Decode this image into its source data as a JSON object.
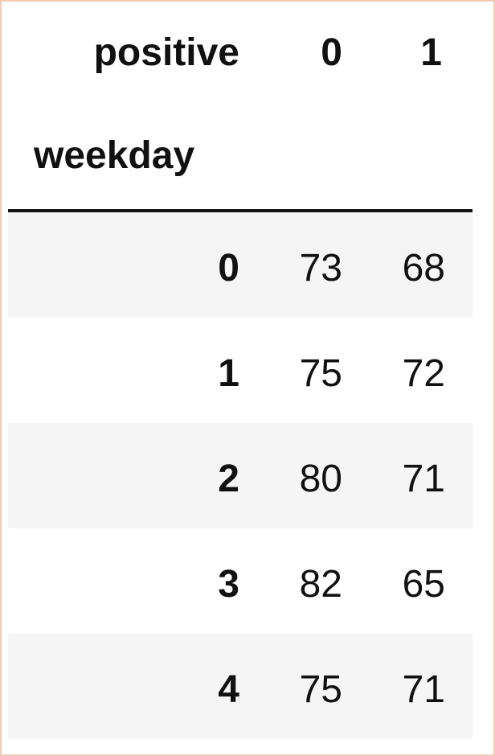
{
  "table": {
    "columns_name": "positive",
    "index_name": "weekday",
    "columns": [
      "0",
      "1"
    ],
    "rows": [
      {
        "index": "0",
        "values": [
          "73",
          "68"
        ]
      },
      {
        "index": "1",
        "values": [
          "75",
          "72"
        ]
      },
      {
        "index": "2",
        "values": [
          "80",
          "71"
        ]
      },
      {
        "index": "3",
        "values": [
          "82",
          "65"
        ]
      },
      {
        "index": "4",
        "values": [
          "75",
          "71"
        ]
      }
    ]
  }
}
